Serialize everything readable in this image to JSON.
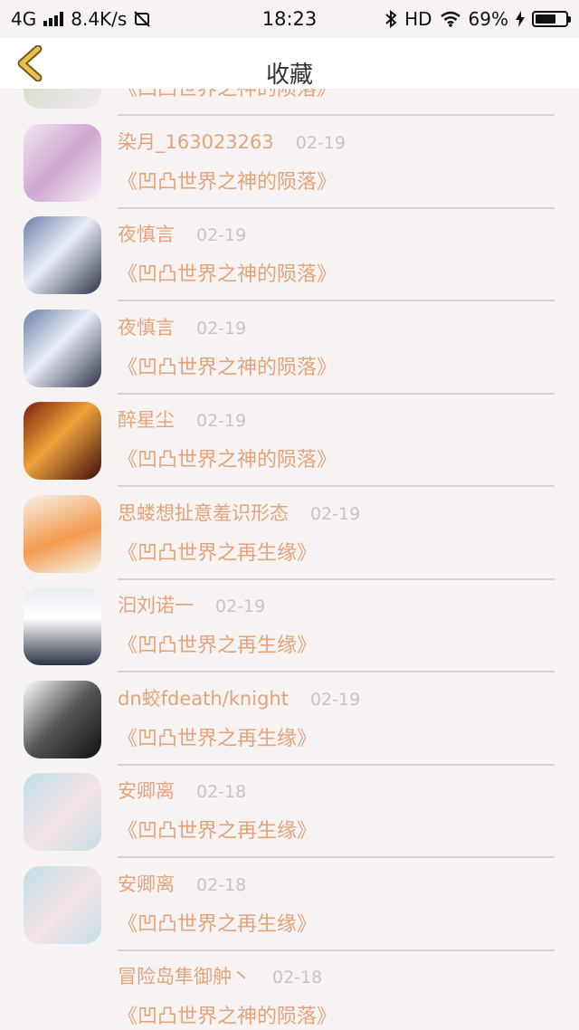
{
  "status_bar": {
    "network": "4G",
    "speed": "8.4K/s",
    "time": "18:23",
    "hd": "HD",
    "battery": "69%",
    "battery_level": 0.69
  },
  "nav": {
    "title": "收藏"
  },
  "items": [
    {
      "name": "",
      "date": "",
      "work": "《凹凸世界之神的陨落》"
    },
    {
      "name": "染月_163023263",
      "date": "02-19",
      "work": "《凹凸世界之神的陨落》"
    },
    {
      "name": "夜慎言",
      "date": "02-19",
      "work": "《凹凸世界之神的陨落》"
    },
    {
      "name": "夜慎言",
      "date": "02-19",
      "work": "《凹凸世界之神的陨落》"
    },
    {
      "name": "醉星尘",
      "date": "02-19",
      "work": "《凹凸世界之神的陨落》"
    },
    {
      "name": "思蝼想扯意羞识形态",
      "date": "02-19",
      "work": "《凹凸世界之再生缘》"
    },
    {
      "name": "汩刘诺一",
      "date": "02-19",
      "work": "《凹凸世界之再生缘》"
    },
    {
      "name": "dn蛟fdeath/knight",
      "date": "02-19",
      "work": "《凹凸世界之再生缘》"
    },
    {
      "name": "安卿离",
      "date": "02-18",
      "work": "《凹凸世界之再生缘》"
    },
    {
      "name": "安卿离",
      "date": "02-18",
      "work": "《凹凸世界之再生缘》"
    },
    {
      "name": "冒险岛隼御舯丶",
      "date": "02-18",
      "work": "《凹凸世界之神的陨落》"
    }
  ],
  "colors": {
    "accent": "#e3a37a",
    "date": "#c9c3c3",
    "back_arrow": "#e8c24a",
    "background": "#f7f3f3"
  }
}
